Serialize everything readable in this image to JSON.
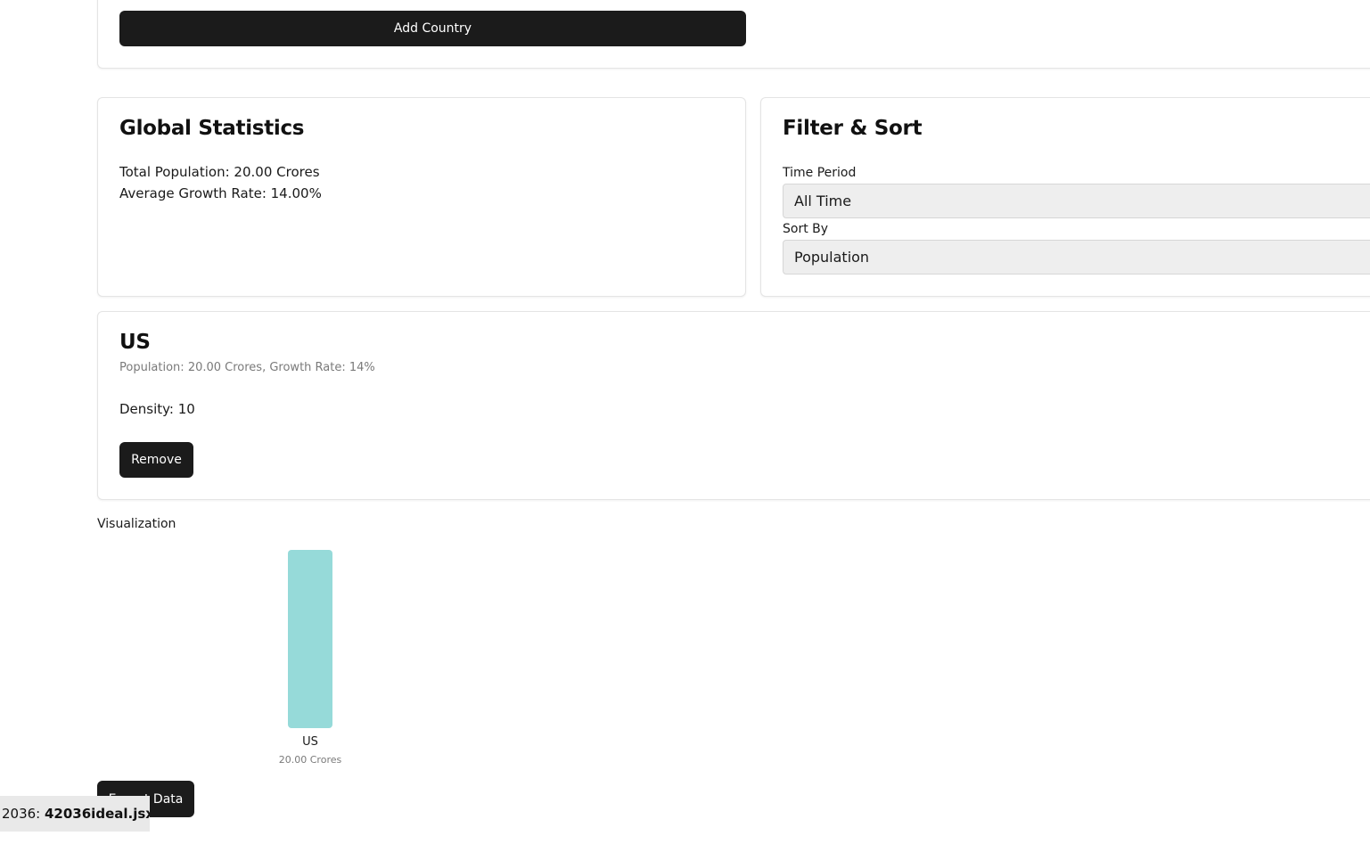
{
  "add_country": {
    "button_label": "Add Country"
  },
  "global_statistics": {
    "title": "Global Statistics",
    "total_population": "Total Population: 20.00 Crores",
    "average_growth_rate": "Average Growth Rate: 14.00%"
  },
  "filter_sort": {
    "title": "Filter & Sort",
    "time_period_label": "Time Period",
    "time_period_value": "All Time",
    "sort_by_label": "Sort By",
    "sort_by_value": "Population"
  },
  "country_card": {
    "name": "US",
    "summary": "Population: 20.00 Crores, Growth Rate: 14%",
    "density": "Density: 10",
    "remove_label": "Remove"
  },
  "visualization": {
    "title": "Visualization",
    "bar_color": "#96dad9"
  },
  "chart_data": {
    "type": "bar",
    "categories": [
      "US"
    ],
    "values": [
      20.0
    ],
    "value_labels": [
      "20.00 Crores"
    ],
    "title": "",
    "xlabel": "",
    "ylabel": ""
  },
  "export": {
    "button_label": "Export Data"
  },
  "status_bar": {
    "prefix": "2036: ",
    "filename": "42036ideal.jsx"
  }
}
